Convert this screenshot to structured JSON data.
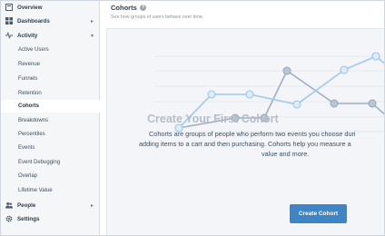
{
  "sidebar": {
    "overview": "Overview",
    "dashboards": "Dashboards",
    "activity": "Activity",
    "activity_items": [
      "Active Users",
      "Revenue",
      "Funnels",
      "Retention",
      "Cohorts",
      "Breakdowns",
      "Percentiles",
      "Events",
      "Event Debugging",
      "Overlap",
      "Lifetime Value"
    ],
    "people": "People",
    "settings": "Settings"
  },
  "header": {
    "title": "Cohorts",
    "subtitle": "See how groups of users behave over time."
  },
  "empty_state": {
    "title": "Create Your First Cohort",
    "line1": "Cohorts are groups of people who perform two events you choose duri",
    "line2": "adding items to a cart and then purchasing. Cohorts help you measure a",
    "line3": "value and more.",
    "button": "Create Cohort"
  },
  "colors": {
    "accent": "#3e85c6",
    "line_light": "#a9cdec",
    "line_gray": "#9aa9b9"
  }
}
